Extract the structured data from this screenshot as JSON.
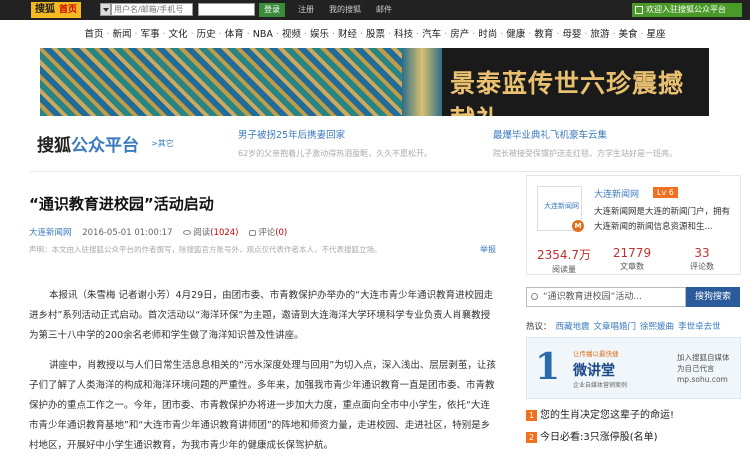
{
  "topbar": {
    "logo": "搜狐",
    "home": "首页",
    "account_placeholder": "用户名/邮箱/手机号",
    "login": "登录",
    "register": "注册",
    "my_sohu": "我的搜狐",
    "mail": "邮件",
    "welcome": "欢迎入驻搜狐公众平台"
  },
  "nav": [
    "首页",
    "新闻",
    "军事",
    "文化",
    "历史",
    "体育",
    "NBA",
    "视频",
    "娱乐",
    "财经",
    "股票",
    "科技",
    "汽车",
    "房产",
    "时尚",
    "健康",
    "教育",
    "母婴",
    "旅游",
    "美食",
    "星座"
  ],
  "banner": {
    "text": "景泰蓝传世六珍震撼献礼"
  },
  "platform": {
    "title_black": "搜狐",
    "title_blue": "公众平台",
    "other": ">其它",
    "hot": [
      {
        "title": "男子被拐25年后携妻回家",
        "desc": "62岁的父亲抱着儿子激动得热泪盈眶，久久不愿松开。"
      },
      {
        "title": "最爆毕业典礼飞机豪车云集",
        "desc": "院长被接受保镖护送走红毯，方学生站好是一班亮。"
      }
    ]
  },
  "article": {
    "title": "“通识教育进校园”活动启动",
    "source": "大连新闻网",
    "date": "2016-05-01 01:00:17",
    "read_label": "阅读",
    "read_count": "(1024)",
    "comment_label": "评论",
    "comment_count": "(0)",
    "statement": "声明：本文由入驻搜狐公众平台的作者撰写，除搜狐官方账号外，观点仅代表作者本人，不代表搜狐立场。",
    "report": "举报",
    "p1": "本报讯（朱雪梅 记者谢小芳）4月29日，由团市委、市青教保护办举办的“大连市青少年通识教育进校园走进乡村”系列活动正式启动。首次活动以“海洋环保”为主题，邀请到大连海洋大学环境科学专业负责人肖襄教授为第三十八中学的200余名老师和学生做了海洋知识普及性讲座。",
    "p2": "讲座中，肖教授以与人们日常生活息息相关的“污水深度处理与回用”为切入点，深入浅出、层层剥茧，让孩子们了解了人类海洋的构成和海洋环境问题的严重性。多年来，加强我市青少年通识教育一直是团市委、市青教保护办的重点工作之一。今年，团市委、市青教保护办将进一步加大力度，重点面向全市中小学生，依托“大连市青少年通识教育基地”和“大连市青少年通识教育讲师团”的阵地和师资力量，走进校园、走进社区，特别是乡村地区，开展好中小学生通识教育，为我市青少年的健康成长保驾护航。"
  },
  "sidebar": {
    "logo_text": "大连新闻网",
    "badge": "M",
    "name": "大连新闻网",
    "level": "Lv 6",
    "desc": "大连新闻网是大连的新闻门户，拥有大连新闻的新闻信息资源和生...",
    "stats": [
      {
        "value": "2354.7万",
        "label": "阅读量"
      },
      {
        "value": "21779",
        "label": "文章数"
      },
      {
        "value": "33",
        "label": "评论数"
      }
    ],
    "search_value": "“通识教育进校园”活动...",
    "search_button": "搜狗搜索",
    "hot_label": "热议：",
    "hot_keywords": [
      "西藏地震",
      "文章唱婚门",
      "徐熙媛曲",
      "李世卓去世"
    ],
    "ad": {
      "number": "1",
      "top": "让传播以最快捷",
      "big": "微讲堂",
      "sub": "企业自媒体营销案例",
      "right_line1": "加入搜狐自媒体",
      "right_line2": "为自己代言",
      "right_line3": "mp.sohu.com"
    },
    "ranks": [
      {
        "no": "1",
        "title": "您的生肖决定您这辈子的命运!"
      },
      {
        "no": "2",
        "title": "今日必看:3只涨停股(名单)"
      }
    ]
  }
}
